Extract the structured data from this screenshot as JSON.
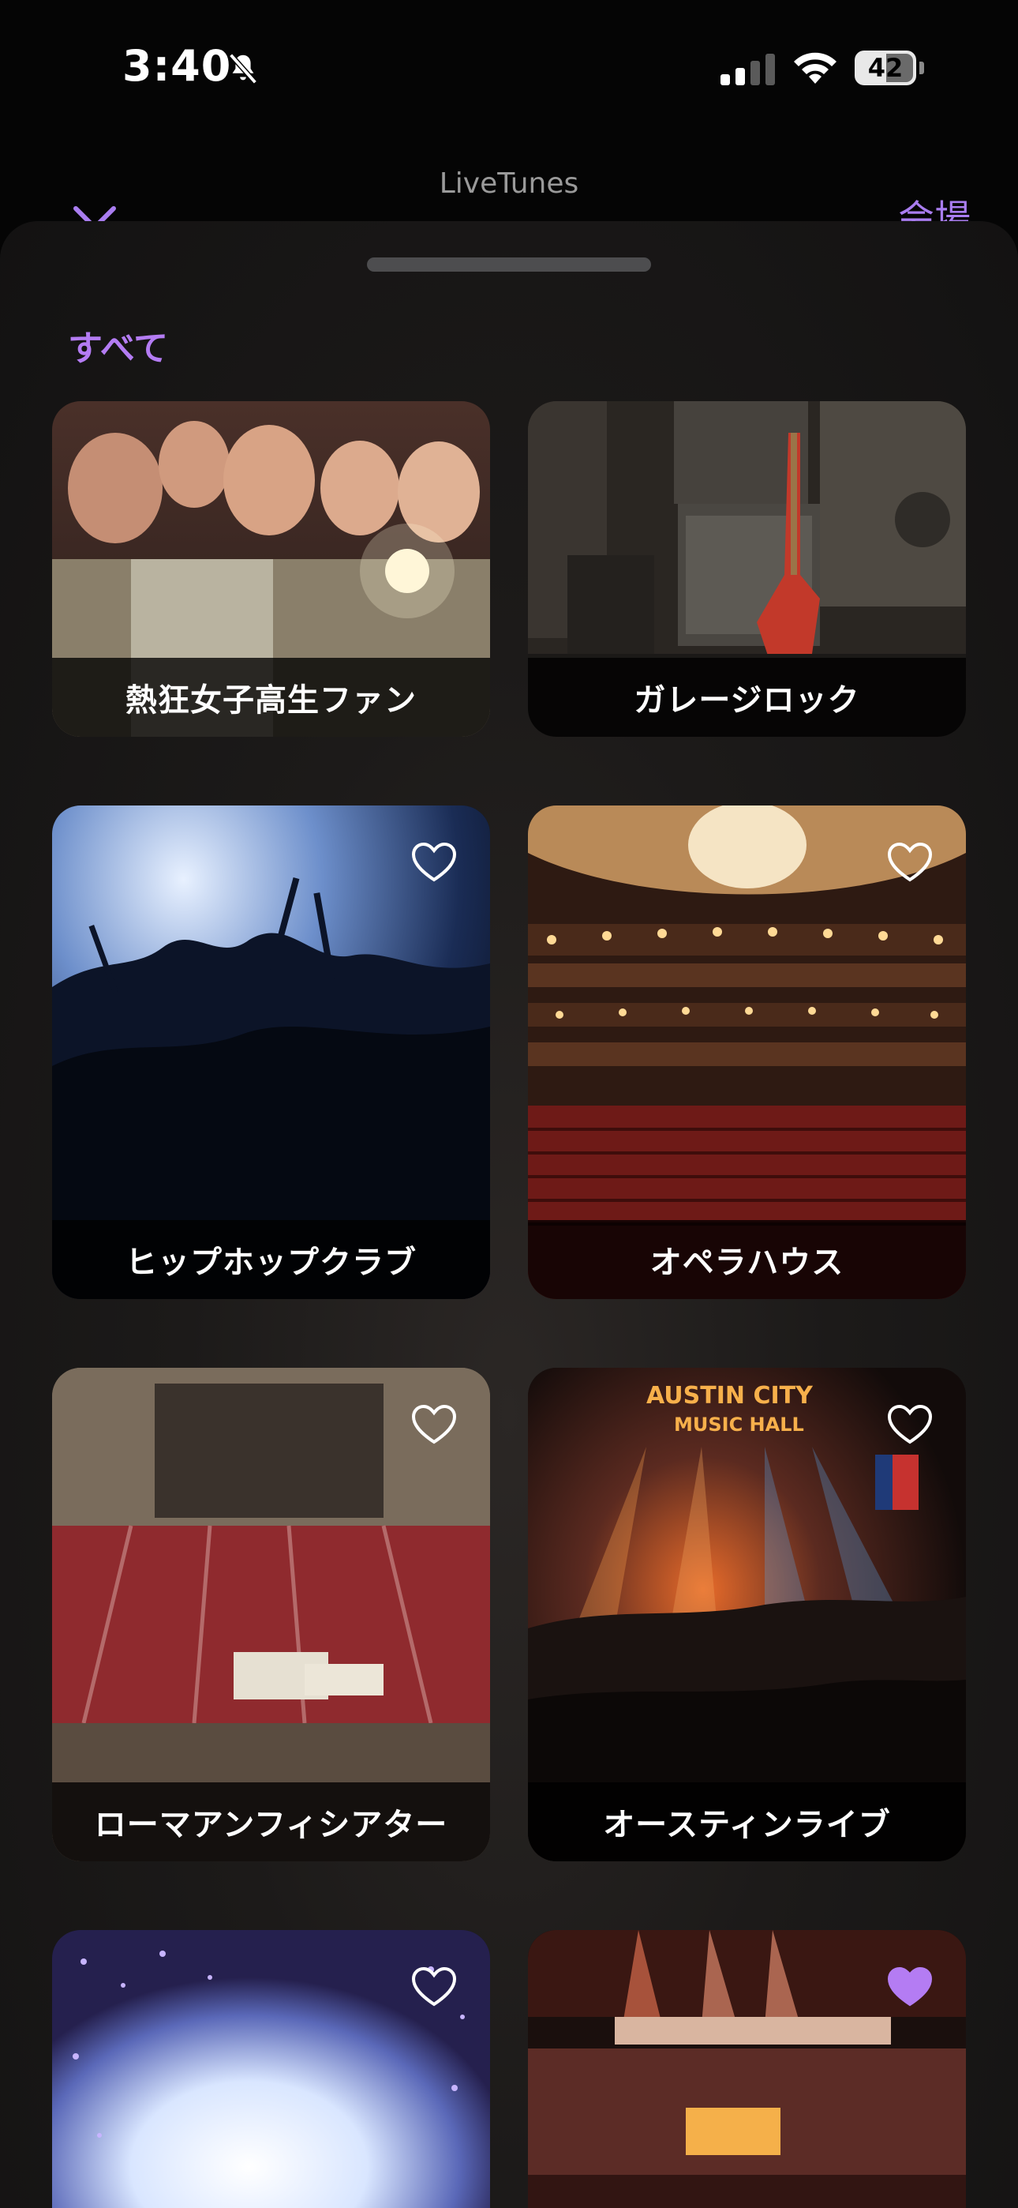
{
  "status_bar": {
    "time": "3:40",
    "battery": "42"
  },
  "nav": {
    "app_name": "LiveTunes",
    "right_action": "会場"
  },
  "section": {
    "title": "すべて"
  },
  "venues": [
    {
      "label": "熱狂女子高生ファン",
      "favorite": false,
      "heart_shown": false
    },
    {
      "label": "ガレージロック",
      "favorite": false,
      "heart_shown": false
    },
    {
      "label": "ヒップホップクラブ",
      "favorite": false,
      "heart_shown": true
    },
    {
      "label": "オペラハウス",
      "favorite": false,
      "heart_shown": true
    },
    {
      "label": "ローマアンフィシアター",
      "favorite": false,
      "heart_shown": true
    },
    {
      "label": "オースティンライブ",
      "favorite": false,
      "heart_shown": true
    },
    {
      "label": "",
      "favorite": false,
      "heart_shown": true
    },
    {
      "label": "",
      "favorite": true,
      "heart_shown": true
    }
  ],
  "sign_text": [
    "AUSTIN CITY",
    "MUSIC HALL"
  ],
  "colors": {
    "accent": "#b47cf3",
    "favorite": "#b47cf3",
    "background": "#050505"
  }
}
